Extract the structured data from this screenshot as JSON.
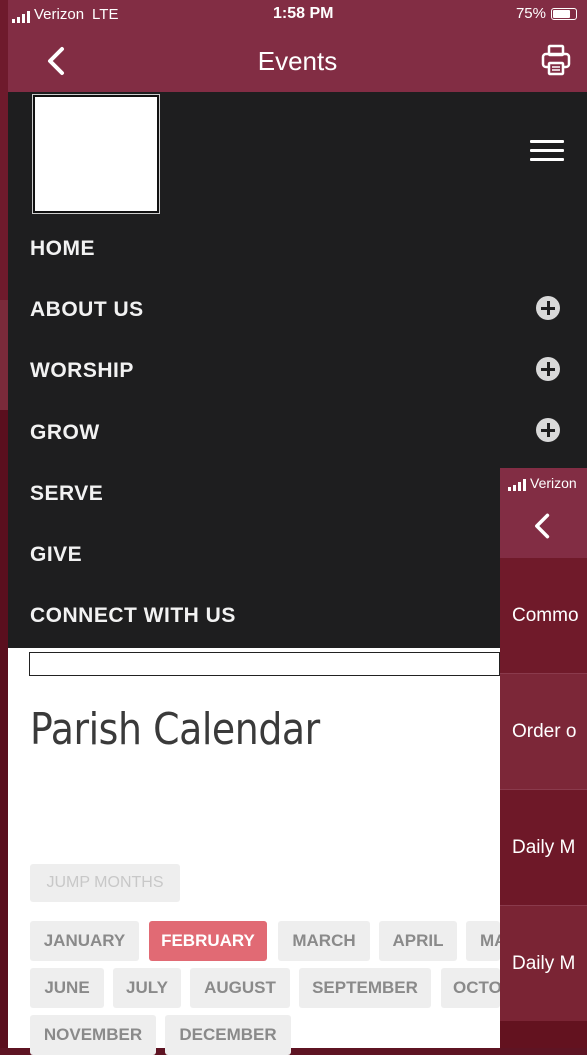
{
  "status_bar": {
    "carrier": "Verizon",
    "network": "LTE",
    "time": "1:58 PM",
    "battery": "75%",
    "battery_level": 0.75
  },
  "nav": {
    "title": "Events",
    "back_icon": "chevron-left-icon",
    "print_icon": "printer-icon"
  },
  "menu": {
    "items": [
      {
        "label": "HOME",
        "expandable": false
      },
      {
        "label": "ABOUT US",
        "expandable": true
      },
      {
        "label": "WORSHIP",
        "expandable": true
      },
      {
        "label": "GROW",
        "expandable": true
      },
      {
        "label": "SERVE",
        "expandable": false
      },
      {
        "label": "GIVE",
        "expandable": false
      },
      {
        "label": "CONNECT WITH US",
        "expandable": false
      }
    ]
  },
  "calendar": {
    "title": "Parish Calendar",
    "jump_label": "JUMP MONTHS",
    "months": [
      "JANUARY",
      "FEBRUARY",
      "MARCH",
      "APRIL",
      "MA",
      "JUNE",
      "JULY",
      "AUGUST",
      "SEPTEMBER",
      "OCTO",
      "NOVEMBER",
      "DECEMBER"
    ],
    "selected_month": "FEBRUARY",
    "accent_color": "#e16a74"
  },
  "side_panel": {
    "carrier": "Verizon",
    "rows": [
      "Commo",
      "Order o",
      "Daily M",
      "Daily M"
    ]
  },
  "colors": {
    "brand": "#822d44",
    "menu_bg": "#1e1e1f"
  }
}
